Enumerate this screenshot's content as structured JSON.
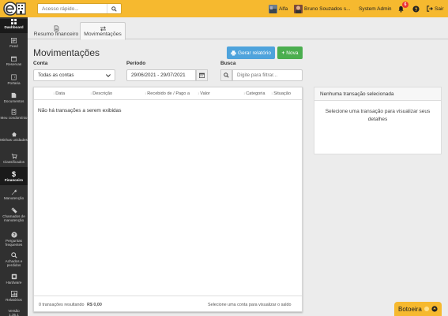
{
  "topbar": {
    "search_placeholder": "Acesso rápido...",
    "condo_name": "Alfa",
    "user_name": "Bruno Souzados s...",
    "role": "System Admin",
    "notification_count": "6",
    "logout_label": "Sair"
  },
  "sidebar": {
    "items": [
      {
        "label": "Dashboard",
        "icon": "dashboard-icon"
      },
      {
        "label": "Feed",
        "icon": "feed-icon"
      },
      {
        "label": "Reservas",
        "icon": "calendar-icon"
      },
      {
        "label": "Portaria",
        "icon": "doorman-icon"
      },
      {
        "label": "Documentos",
        "icon": "document-icon"
      },
      {
        "label": "Meu condomínio",
        "icon": "building-icon"
      },
      {
        "label": "Minhas unidades",
        "icon": "home-icon"
      },
      {
        "label": "Classificados",
        "icon": "cart-icon"
      },
      {
        "label": "Financeiro",
        "icon": "dollar-icon"
      },
      {
        "label": "Manutenção",
        "icon": "wrench-icon"
      },
      {
        "label": "Chamados de manutenção",
        "icon": "ticket-icon"
      },
      {
        "label": "Perguntas frequentes",
        "icon": "question-icon"
      },
      {
        "label": "Achados e perdidos",
        "icon": "search-icon"
      },
      {
        "label": "Hardware",
        "icon": "hardware-icon"
      },
      {
        "label": "Relatórios",
        "icon": "report-icon"
      },
      {
        "label": "Versão 1.35.1",
        "icon": ""
      }
    ]
  },
  "tabs": [
    {
      "label": "Resumo financeiro",
      "icon": "document-icon"
    },
    {
      "label": "Movimentações",
      "icon": "transfer-icon"
    }
  ],
  "page": {
    "title": "Movimentações",
    "report_button": "Gerar relatório",
    "new_button": "Nova"
  },
  "filters": {
    "account_label": "Conta",
    "account_value": "Todas as contas",
    "period_label": "Período",
    "period_value": "29/06/2021 - 29/07/2021",
    "search_label": "Busca",
    "search_placeholder": "Digite para filtrar..."
  },
  "table": {
    "columns": [
      "Data",
      "Descrição",
      "Recebido de / Pago a",
      "Valor",
      "Categoria",
      "Situação"
    ],
    "empty_message": "Não há transações a serem exibidas",
    "footer_count": "0 transações resultando",
    "footer_total": "R$ 0,00",
    "footer_hint": "Selecione uma conta para visualizar o saldo"
  },
  "detail": {
    "header": "Nenhuma transação selecionada",
    "body": "Selecione uma transação para visualizar seus detalhes"
  },
  "botoeira_label": "Botoeira",
  "colors": {
    "brand": "#f6b92f",
    "sidebar": "#303030",
    "primary": "#4ea3dc",
    "success": "#4bae4f"
  }
}
